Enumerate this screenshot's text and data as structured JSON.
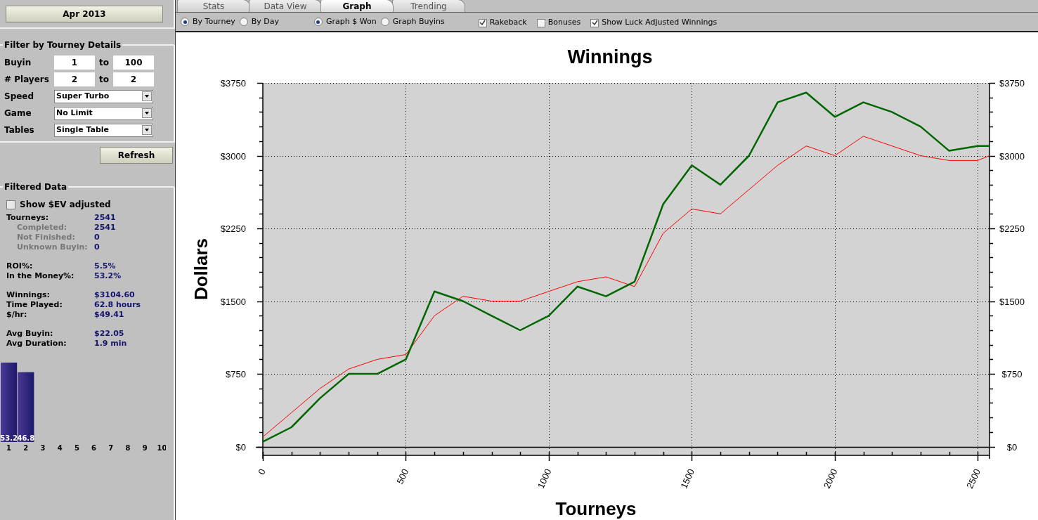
{
  "sidebar": {
    "period_button": "Apr 2013",
    "filter": {
      "title": "Filter by Tourney Details",
      "ranges": [
        {
          "label": "Buyin",
          "from": "1",
          "joiner": "to",
          "to": "100"
        },
        {
          "label": "# Players",
          "from": "2",
          "joiner": "to",
          "to": "2"
        }
      ],
      "selects": [
        {
          "label": "Speed",
          "value": "Super Turbo"
        },
        {
          "label": "Game",
          "value": "No Limit"
        },
        {
          "label": "Tables",
          "value": "Single Table"
        }
      ]
    },
    "refresh_button": "Refresh",
    "filtered": {
      "title": "Filtered Data",
      "ev_checkbox": {
        "label": "Show $EV adjusted",
        "checked": false
      },
      "groups": [
        [
          {
            "label": "Tourneys:",
            "value": "2541",
            "kind": "main"
          },
          {
            "label": "Completed:",
            "value": "2541",
            "kind": "sub"
          },
          {
            "label": "Not Finished:",
            "value": "0",
            "kind": "sub"
          },
          {
            "label": "Unknown Buyin:",
            "value": "0",
            "kind": "sub"
          }
        ],
        [
          {
            "label": "ROI%:",
            "value": "5.5%",
            "kind": "main"
          },
          {
            "label": "In the Money%:",
            "value": "53.2%",
            "kind": "main"
          }
        ],
        [
          {
            "label": "Winnings:",
            "value": "$3104.60",
            "kind": "main"
          },
          {
            "label": "Time Played:",
            "value": "62.8 hours",
            "kind": "main"
          },
          {
            "label": "$/hr:",
            "value": "$49.41",
            "kind": "main"
          }
        ],
        [
          {
            "label": "Avg Buyin:",
            "value": "$22.05",
            "kind": "main"
          },
          {
            "label": "Avg Duration:",
            "value": "1.9 min",
            "kind": "main"
          }
        ]
      ],
      "chart_data": {
        "type": "bar",
        "categories": [
          "1",
          "2",
          "3",
          "4",
          "5",
          "6",
          "7",
          "8",
          "9",
          "10"
        ],
        "values": [
          53.2,
          46.8,
          null,
          null,
          null,
          null,
          null,
          null,
          null,
          null
        ],
        "data_labels": true
      }
    }
  },
  "tabs": [
    {
      "label": "Stats",
      "selected": false
    },
    {
      "label": "Data View",
      "selected": false
    },
    {
      "label": "Graph",
      "selected": true
    },
    {
      "label": "Trending",
      "selected": false
    }
  ],
  "options": {
    "radio_groups": [
      [
        {
          "label": "By Tourney",
          "selected": true
        },
        {
          "label": "By Day",
          "selected": false
        }
      ],
      [
        {
          "label": "Graph $ Won",
          "selected": true
        },
        {
          "label": "Graph Buyins",
          "selected": false
        }
      ]
    ],
    "checkboxes": [
      {
        "label": "Rakeback",
        "checked": true
      },
      {
        "label": "Bonuses",
        "checked": false
      },
      {
        "label": "Show Luck Adjusted Winnings",
        "checked": true
      }
    ]
  },
  "graph": {
    "chart_data": {
      "type": "line",
      "title": "Winnings",
      "xlabel": "Tourneys",
      "ylabel": "Dollars",
      "x": [
        0,
        100,
        200,
        300,
        400,
        500,
        600,
        700,
        800,
        900,
        1000,
        1100,
        1200,
        1300,
        1400,
        1500,
        1600,
        1700,
        1800,
        1900,
        2000,
        2100,
        2200,
        2300,
        2400,
        2500,
        2541
      ],
      "series": [
        {
          "color": "#006600",
          "values": [
            50,
            200,
            500,
            750,
            750,
            900,
            1600,
            1500,
            1350,
            1200,
            1350,
            1650,
            1550,
            1700,
            2500,
            2900,
            2700,
            3000,
            3550,
            3650,
            3400,
            3550,
            3450,
            3300,
            3050,
            3100,
            3100
          ]
        },
        {
          "color": "#ff0000",
          "values": [
            100,
            350,
            600,
            800,
            900,
            950,
            1350,
            1550,
            1500,
            1500,
            1600,
            1700,
            1750,
            1650,
            2200,
            2450,
            2400,
            2650,
            2900,
            3100,
            3000,
            3200,
            3100,
            3000,
            2950,
            2950,
            3000
          ]
        }
      ],
      "grid": true,
      "xlim": [
        0,
        2541
      ],
      "ylim": [
        -90,
        3750
      ],
      "xticks": [
        0,
        500,
        1000,
        1500,
        2000,
        2500
      ],
      "yticks": [
        {
          "value": 0,
          "label": "$0"
        },
        {
          "value": 750,
          "label": "$750"
        },
        {
          "value": 1500,
          "label": "$1500"
        },
        {
          "value": 2250,
          "label": "$2250"
        },
        {
          "value": 3000,
          "label": "$3000"
        },
        {
          "value": 3750,
          "label": "$3750"
        }
      ]
    }
  }
}
